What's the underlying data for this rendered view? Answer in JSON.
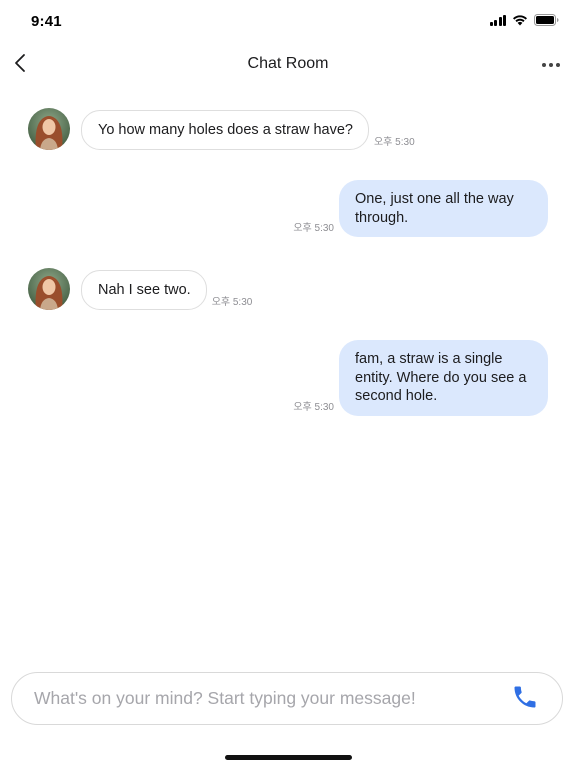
{
  "status_bar": {
    "time": "9:41",
    "icons": [
      "signal-icon",
      "wifi-icon",
      "battery-icon"
    ]
  },
  "header": {
    "title": "Chat Room",
    "back_icon": "chevron-left-icon",
    "more_icon": "more-horizontal-icon"
  },
  "messages": [
    {
      "direction": "incoming",
      "text": "Yo how many holes does a straw have?",
      "time": "오후 5:30"
    },
    {
      "direction": "outgoing",
      "text": "One, just one all the way through.",
      "time": "오후 5:30"
    },
    {
      "direction": "incoming",
      "text": "Nah I see two.",
      "time": "오후 5:30"
    },
    {
      "direction": "outgoing",
      "text": "fam, a straw is a single entity. Where do you see a second hole.",
      "time": "오후 5:30"
    }
  ],
  "composer": {
    "value": "",
    "placeholder": "What's on your mind? Start typing your message!",
    "call_icon": "phone-icon"
  },
  "colors": {
    "outgoing_bubble": "#dbe8fd",
    "incoming_border": "#dedede",
    "accent": "#2f6fe4",
    "timestamp": "#8e8e93"
  }
}
